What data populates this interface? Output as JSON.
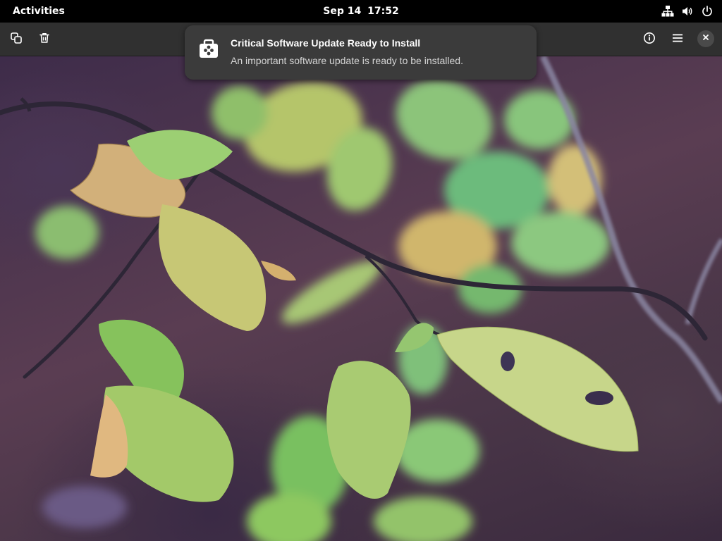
{
  "topbar": {
    "activities_label": "Activities",
    "clock_date": "Sep 14",
    "clock_time": "17:52",
    "tray_icons": [
      "network-wired-icon",
      "volume-icon",
      "power-icon"
    ]
  },
  "viewer": {
    "header_buttons_left": [
      "copy-icon",
      "trash-icon"
    ],
    "header_buttons_right": [
      "info-icon",
      "hamburger-menu-icon",
      "close-icon"
    ],
    "image_subject": "autumn leaves on branch"
  },
  "notification": {
    "icon": "software-package-icon",
    "title": "Critical Software Update Ready to Install",
    "body": "An important software update is ready to be installed."
  },
  "colors": {
    "topbar_bg": "#000000",
    "header_bg": "#303030",
    "notification_bg": "#3b3b3b",
    "text_primary": "#ffffff",
    "text_secondary": "#d4d4d4"
  }
}
